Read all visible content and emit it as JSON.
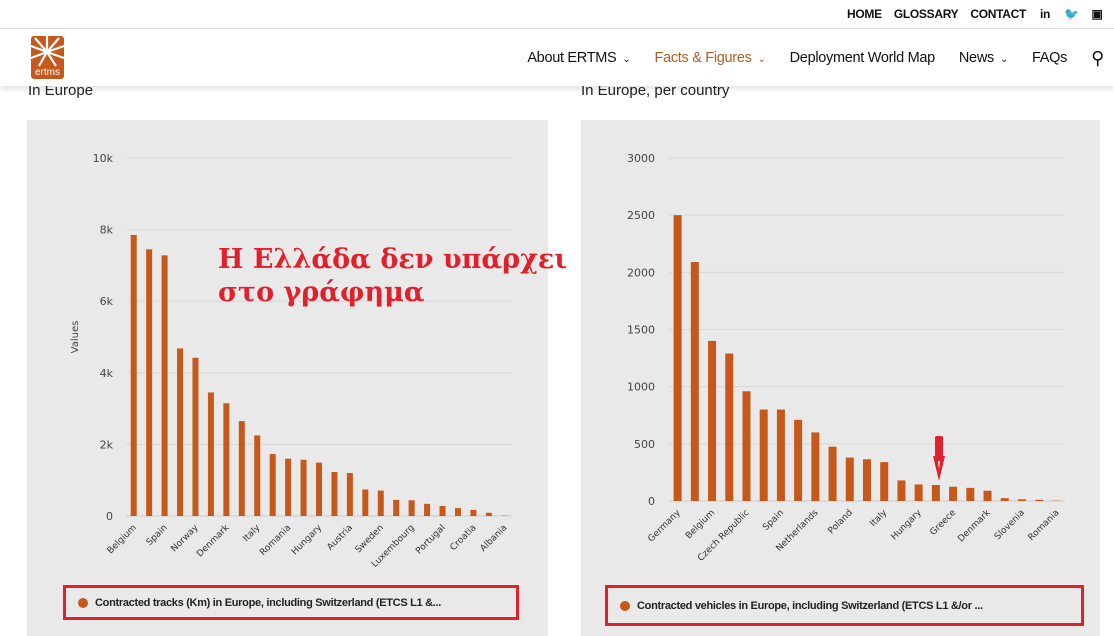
{
  "topbar": {
    "links": [
      "HOME",
      "GLOSSARY",
      "CONTACT"
    ],
    "icons": [
      "linkedin-icon",
      "twitter-icon",
      "podcast-icon"
    ]
  },
  "nav": {
    "logo_text": "ertms",
    "items": [
      {
        "label": "About ERTMS",
        "dropdown": true
      },
      {
        "label": "Facts & Figures",
        "dropdown": true,
        "active": true
      },
      {
        "label": "Deployment World Map",
        "dropdown": false
      },
      {
        "label": "News",
        "dropdown": true
      },
      {
        "label": "FAQs",
        "dropdown": false
      }
    ],
    "search_icon": "search-icon"
  },
  "colors": {
    "accent": "#b75b22",
    "bar": "#c5581a",
    "annotation": "#e0202a",
    "panel": "#e9e9e9"
  },
  "left": {
    "subtitle": "In Europe",
    "annotation_line1": "Η Ελλάδα δεν υπάρχει",
    "annotation_line2": "στο γράφημα",
    "legend": "Contracted tracks (Km) in Europe, including Switzerland (ETCS L1 &..."
  },
  "right": {
    "subtitle": "In Europe, per country",
    "legend": "Contracted vehicles in Europe, including Switzerland (ETCS L1 &/or ..."
  },
  "chart_data": [
    {
      "type": "bar",
      "ylabel": "Values",
      "ylim": [
        0,
        10000
      ],
      "yticks": [
        "0",
        "2k",
        "4k",
        "6k",
        "8k",
        "10k"
      ],
      "ytick_values": [
        0,
        2000,
        4000,
        6000,
        8000,
        10000
      ],
      "grid": true,
      "legend": "bottom",
      "categories": [
        "Belgium",
        "",
        "Spain",
        "",
        "Norway",
        "",
        "Denmark",
        "",
        "Italy",
        "",
        "Romania",
        "",
        "Hungary",
        "",
        "Austria",
        "",
        "Sweden",
        "",
        "Luxembourg",
        "",
        "Portugal",
        "",
        "Croatia",
        "",
        "Albania"
      ],
      "series": [
        {
          "name": "Contracted tracks (Km) in Europe, including Switzerland (ETCS L1 &...",
          "values": [
            7850,
            7450,
            7280,
            4680,
            4420,
            3450,
            3150,
            2650,
            2250,
            1730,
            1600,
            1570,
            1490,
            1230,
            1200,
            740,
            710,
            450,
            440,
            340,
            280,
            220,
            170,
            90,
            10
          ]
        }
      ]
    },
    {
      "type": "bar",
      "ylim": [
        0,
        3000
      ],
      "yticks": [
        "0",
        "500",
        "1000",
        "1500",
        "2000",
        "2500",
        "3000"
      ],
      "ytick_values": [
        0,
        500,
        1000,
        1500,
        2000,
        2500,
        3000
      ],
      "grid": true,
      "legend": "bottom",
      "categories": [
        "Germany",
        "",
        "Belgium",
        "",
        "Czech Republic",
        "",
        "Spain",
        "",
        "Netherlands",
        "",
        "Poland",
        "",
        "Italy",
        "",
        "Hungary",
        "",
        "Greece",
        "",
        "Denmark",
        "",
        "Slovenia",
        "",
        "Romania"
      ],
      "series": [
        {
          "name": "Contracted vehicles in Europe, including Switzerland (ETCS L1 &/or ...",
          "values": [
            2500,
            2090,
            1400,
            1290,
            960,
            800,
            800,
            710,
            600,
            475,
            380,
            365,
            340,
            180,
            145,
            140,
            125,
            115,
            90,
            25,
            15,
            10,
            3
          ]
        }
      ]
    }
  ]
}
